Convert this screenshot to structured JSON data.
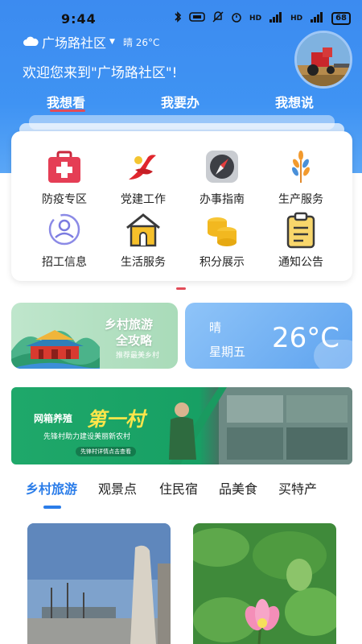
{
  "status_bar": {
    "time": "9:44",
    "network_labels": [
      "HD",
      "4G",
      "HD",
      "4G"
    ],
    "battery": "68"
  },
  "header": {
    "community": "广场路社区",
    "weather_brief": "晴 26°C",
    "welcome": "欢迎您来到\"广场路社区\"!",
    "tabs": [
      "我想看",
      "我要办",
      "我想说"
    ],
    "active_tab": 0
  },
  "services": [
    {
      "label": "防疫专区",
      "icon": "first-aid-kit-icon"
    },
    {
      "label": "党建工作",
      "icon": "party-emblem-icon"
    },
    {
      "label": "办事指南",
      "icon": "compass-icon"
    },
    {
      "label": "生产服务",
      "icon": "wheat-icon"
    },
    {
      "label": "招工信息",
      "icon": "user-icon"
    },
    {
      "label": "生活服务",
      "icon": "house-icon"
    },
    {
      "label": "积分展示",
      "icon": "coins-icon"
    },
    {
      "label": "通知公告",
      "icon": "clipboard-icon"
    }
  ],
  "promo_tourism": {
    "title_line1": "乡村旅游",
    "title_line2": "全攻略",
    "subtitle": "推荐最美乡村"
  },
  "weather_card": {
    "condition": "晴",
    "day": "星期五",
    "temperature": "26°C"
  },
  "banner": {
    "text_left": "网箱养殖",
    "text_highlight": "第一村",
    "subtitle": "先锋村助力建设美丽新农村",
    "button": "先锋村详情点击查看"
  },
  "categories": [
    "乡村旅游",
    "观景点",
    "住民宿",
    "品美食",
    "买特产"
  ],
  "active_category": 0,
  "colors": {
    "header_blue": "#3f93f3",
    "accent_red": "#e24b58",
    "accent_blue": "#2b7de9",
    "banner_green": "#1fa86a",
    "banner_highlight": "#ffe64a"
  }
}
